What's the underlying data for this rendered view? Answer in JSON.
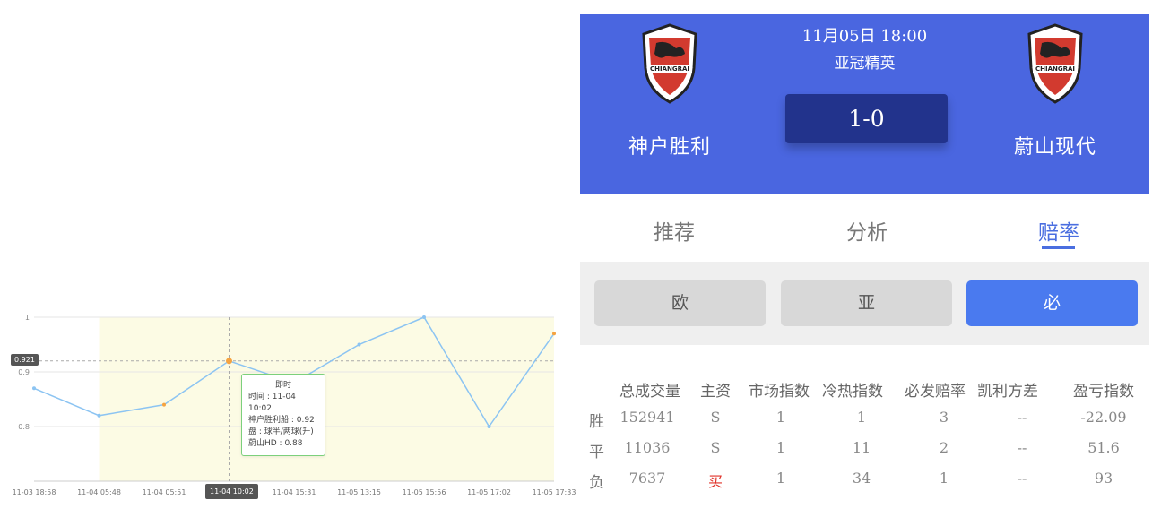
{
  "chart": {
    "y_ticks": [
      "1",
      "0.9",
      "0.8"
    ],
    "x_ticks": [
      "11-03 18:58",
      "11-04 05:48",
      "11-04 05:51",
      "11-04 10:02",
      "11-04 15:31",
      "11-05 13:15",
      "11-05 15:56",
      "11-05 17:02",
      "11-05 17:33"
    ],
    "y_marker": "0.921",
    "x_marker": "11-04 10:02",
    "tooltip": {
      "title": "即时",
      "time": "时间 : 11-04 10:02",
      "home": "神户胜利船 : 0.92",
      "handicap": "盘 : 球半/两球(升)",
      "away": "蔚山HD : 0.88"
    },
    "colors": {
      "line": "#8cc4f2",
      "band": "#fcfbe4",
      "dot_orange": "#f5a340"
    }
  },
  "chart_data": {
    "type": "line",
    "categories": [
      "11-03 18:58",
      "11-04 05:48",
      "11-04 05:51",
      "11-04 10:02",
      "11-04 15:31",
      "11-05 13:15",
      "11-05 15:56",
      "11-05 17:02",
      "11-05 17:33"
    ],
    "values": [
      0.87,
      0.82,
      0.84,
      0.92,
      0.88,
      0.95,
      1.0,
      0.8,
      0.97
    ],
    "ylim": [
      0.7,
      1.0
    ]
  },
  "match": {
    "datetime": "11月05日 18:00",
    "league": "亚冠精英",
    "home": "神户胜利",
    "away": "蔚山现代",
    "score": "1-0",
    "crest_text": "CHIANGRAI"
  },
  "tabs": [
    {
      "label": "推荐"
    },
    {
      "label": "分析"
    },
    {
      "label": "赔率"
    }
  ],
  "subtabs": [
    {
      "label": "欧"
    },
    {
      "label": "亚"
    },
    {
      "label": "必"
    }
  ],
  "table": {
    "headers": [
      "总成交量",
      "主资",
      "市场指数",
      "冷热指数",
      "必发赔率",
      "凯利方差",
      "盈亏指数"
    ],
    "rows": [
      {
        "label": "胜",
        "cells": [
          "152941",
          "S",
          "1",
          "1",
          "3",
          "--",
          "-22.09"
        ]
      },
      {
        "label": "平",
        "cells": [
          "11036",
          "S",
          "1",
          "11",
          "2",
          "--",
          "51.6"
        ]
      },
      {
        "label": "负",
        "cells": [
          "7637",
          "买",
          "1",
          "34",
          "1",
          "--",
          "93"
        ]
      }
    ]
  }
}
